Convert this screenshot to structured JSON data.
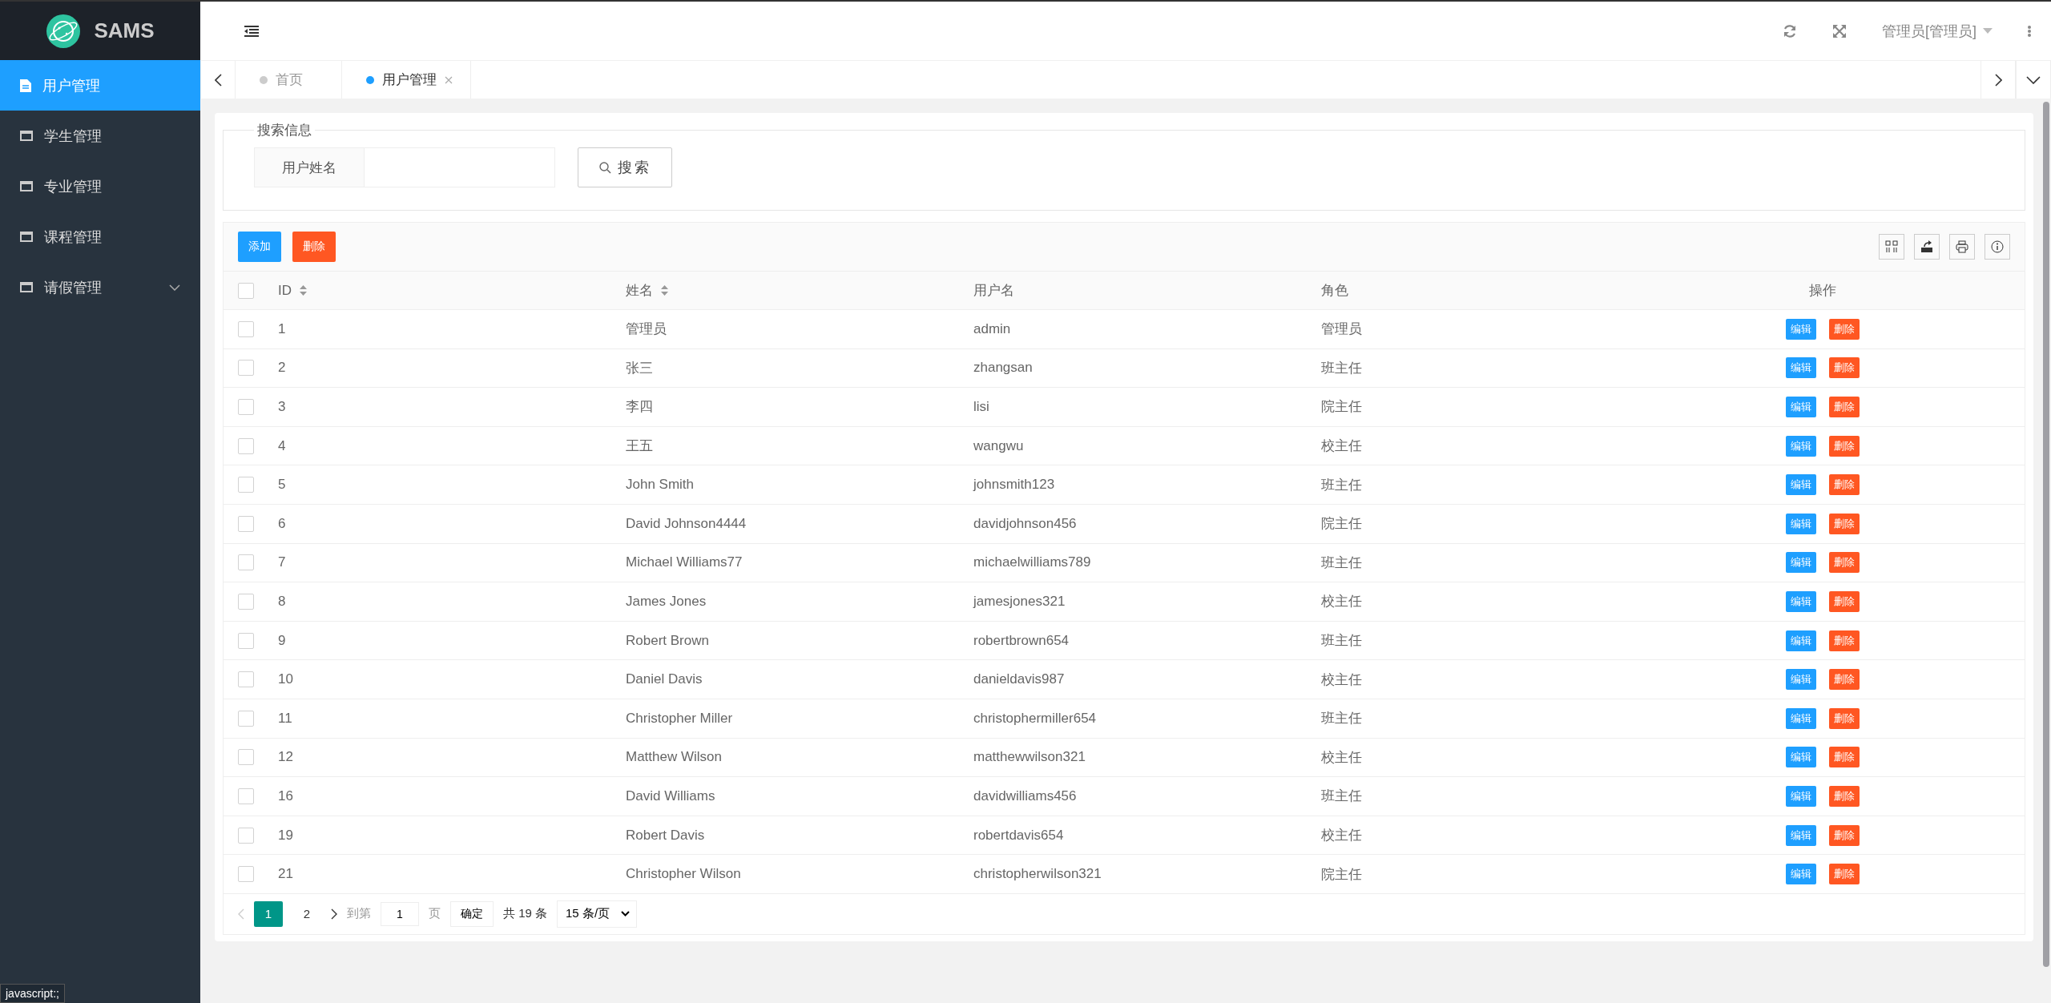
{
  "brand": "SAMS",
  "sidebar": {
    "items": [
      {
        "label": "用户管理",
        "selected": true,
        "has_children": false
      },
      {
        "label": "学生管理",
        "selected": false,
        "has_children": false
      },
      {
        "label": "专业管理",
        "selected": false,
        "has_children": false
      },
      {
        "label": "课程管理",
        "selected": false,
        "has_children": false
      },
      {
        "label": "请假管理",
        "selected": false,
        "has_children": true
      }
    ]
  },
  "header": {
    "user": "管理员[管理员]"
  },
  "tabs": [
    {
      "label": "首页",
      "selected": false,
      "closable": false
    },
    {
      "label": "用户管理",
      "selected": true,
      "closable": true
    }
  ],
  "search": {
    "legend": "搜索信息",
    "field_label": "用户姓名",
    "button": "搜索"
  },
  "toolbar": {
    "buttons": [
      {
        "label": "添加",
        "kind": "primary"
      },
      {
        "label": "删除",
        "kind": "danger"
      }
    ]
  },
  "table": {
    "header_checked": false,
    "columns": [
      {
        "label": "ID",
        "sortable": true
      },
      {
        "label": "姓名",
        "sortable": true
      },
      {
        "label": "用户名",
        "sortable": false
      },
      {
        "label": "角色",
        "sortable": false
      },
      {
        "label": "操作",
        "sortable": false
      }
    ],
    "rows": [
      {
        "checked": false,
        "id": "1",
        "name": "管理员",
        "username": "admin",
        "role": "管理员",
        "actions": [
          "编辑",
          "删除"
        ]
      },
      {
        "checked": false,
        "id": "2",
        "name": "张三",
        "username": "zhangsan",
        "role": "班主任",
        "actions": [
          "编辑",
          "删除"
        ]
      },
      {
        "checked": false,
        "id": "3",
        "name": "李四",
        "username": "lisi",
        "role": "院主任",
        "actions": [
          "编辑",
          "删除"
        ]
      },
      {
        "checked": false,
        "id": "4",
        "name": "王五",
        "username": "wangwu",
        "role": "校主任",
        "actions": [
          "编辑",
          "删除"
        ]
      },
      {
        "checked": false,
        "id": "5",
        "name": "John Smith",
        "username": "johnsmith123",
        "role": "班主任",
        "actions": [
          "编辑",
          "删除"
        ]
      },
      {
        "checked": false,
        "id": "6",
        "name": "David Johnson4444",
        "username": "davidjohnson456",
        "role": "院主任",
        "actions": [
          "编辑",
          "删除"
        ]
      },
      {
        "checked": false,
        "id": "7",
        "name": "Michael Williams77",
        "username": "michaelwilliams789",
        "role": "班主任",
        "actions": [
          "编辑",
          "删除"
        ]
      },
      {
        "checked": false,
        "id": "8",
        "name": "James Jones",
        "username": "jamesjones321",
        "role": "校主任",
        "actions": [
          "编辑",
          "删除"
        ]
      },
      {
        "checked": false,
        "id": "9",
        "name": "Robert Brown",
        "username": "robertbrown654",
        "role": "班主任",
        "actions": [
          "编辑",
          "删除"
        ]
      },
      {
        "checked": false,
        "id": "10",
        "name": "Daniel Davis",
        "username": "danieldavis987",
        "role": "校主任",
        "actions": [
          "编辑",
          "删除"
        ]
      },
      {
        "checked": false,
        "id": "11",
        "name": "Christopher Miller",
        "username": "christophermiller654",
        "role": "班主任",
        "actions": [
          "编辑",
          "删除"
        ]
      },
      {
        "checked": false,
        "id": "12",
        "name": "Matthew Wilson",
        "username": "matthewwilson321",
        "role": "校主任",
        "actions": [
          "编辑",
          "删除"
        ]
      },
      {
        "checked": false,
        "id": "16",
        "name": "David Williams",
        "username": "davidwilliams456",
        "role": "班主任",
        "actions": [
          "编辑",
          "删除"
        ]
      },
      {
        "checked": false,
        "id": "19",
        "name": "Robert Davis",
        "username": "robertdavis654",
        "role": "校主任",
        "actions": [
          "编辑",
          "删除"
        ]
      },
      {
        "checked": false,
        "id": "21",
        "name": "Christopher Wilson",
        "username": "christopherwilson321",
        "role": "院主任",
        "actions": [
          "编辑",
          "删除"
        ]
      }
    ]
  },
  "pagination": {
    "pages": [
      {
        "label": "1",
        "selected": true
      },
      {
        "label": "2",
        "selected": false
      }
    ],
    "goto_label": "到第",
    "goto_value": "1",
    "page_unit": "页",
    "confirm": "确定",
    "total": "共 19 条",
    "page_size": "15 条/页"
  },
  "status_bar": {
    "link": "javascript:;"
  }
}
